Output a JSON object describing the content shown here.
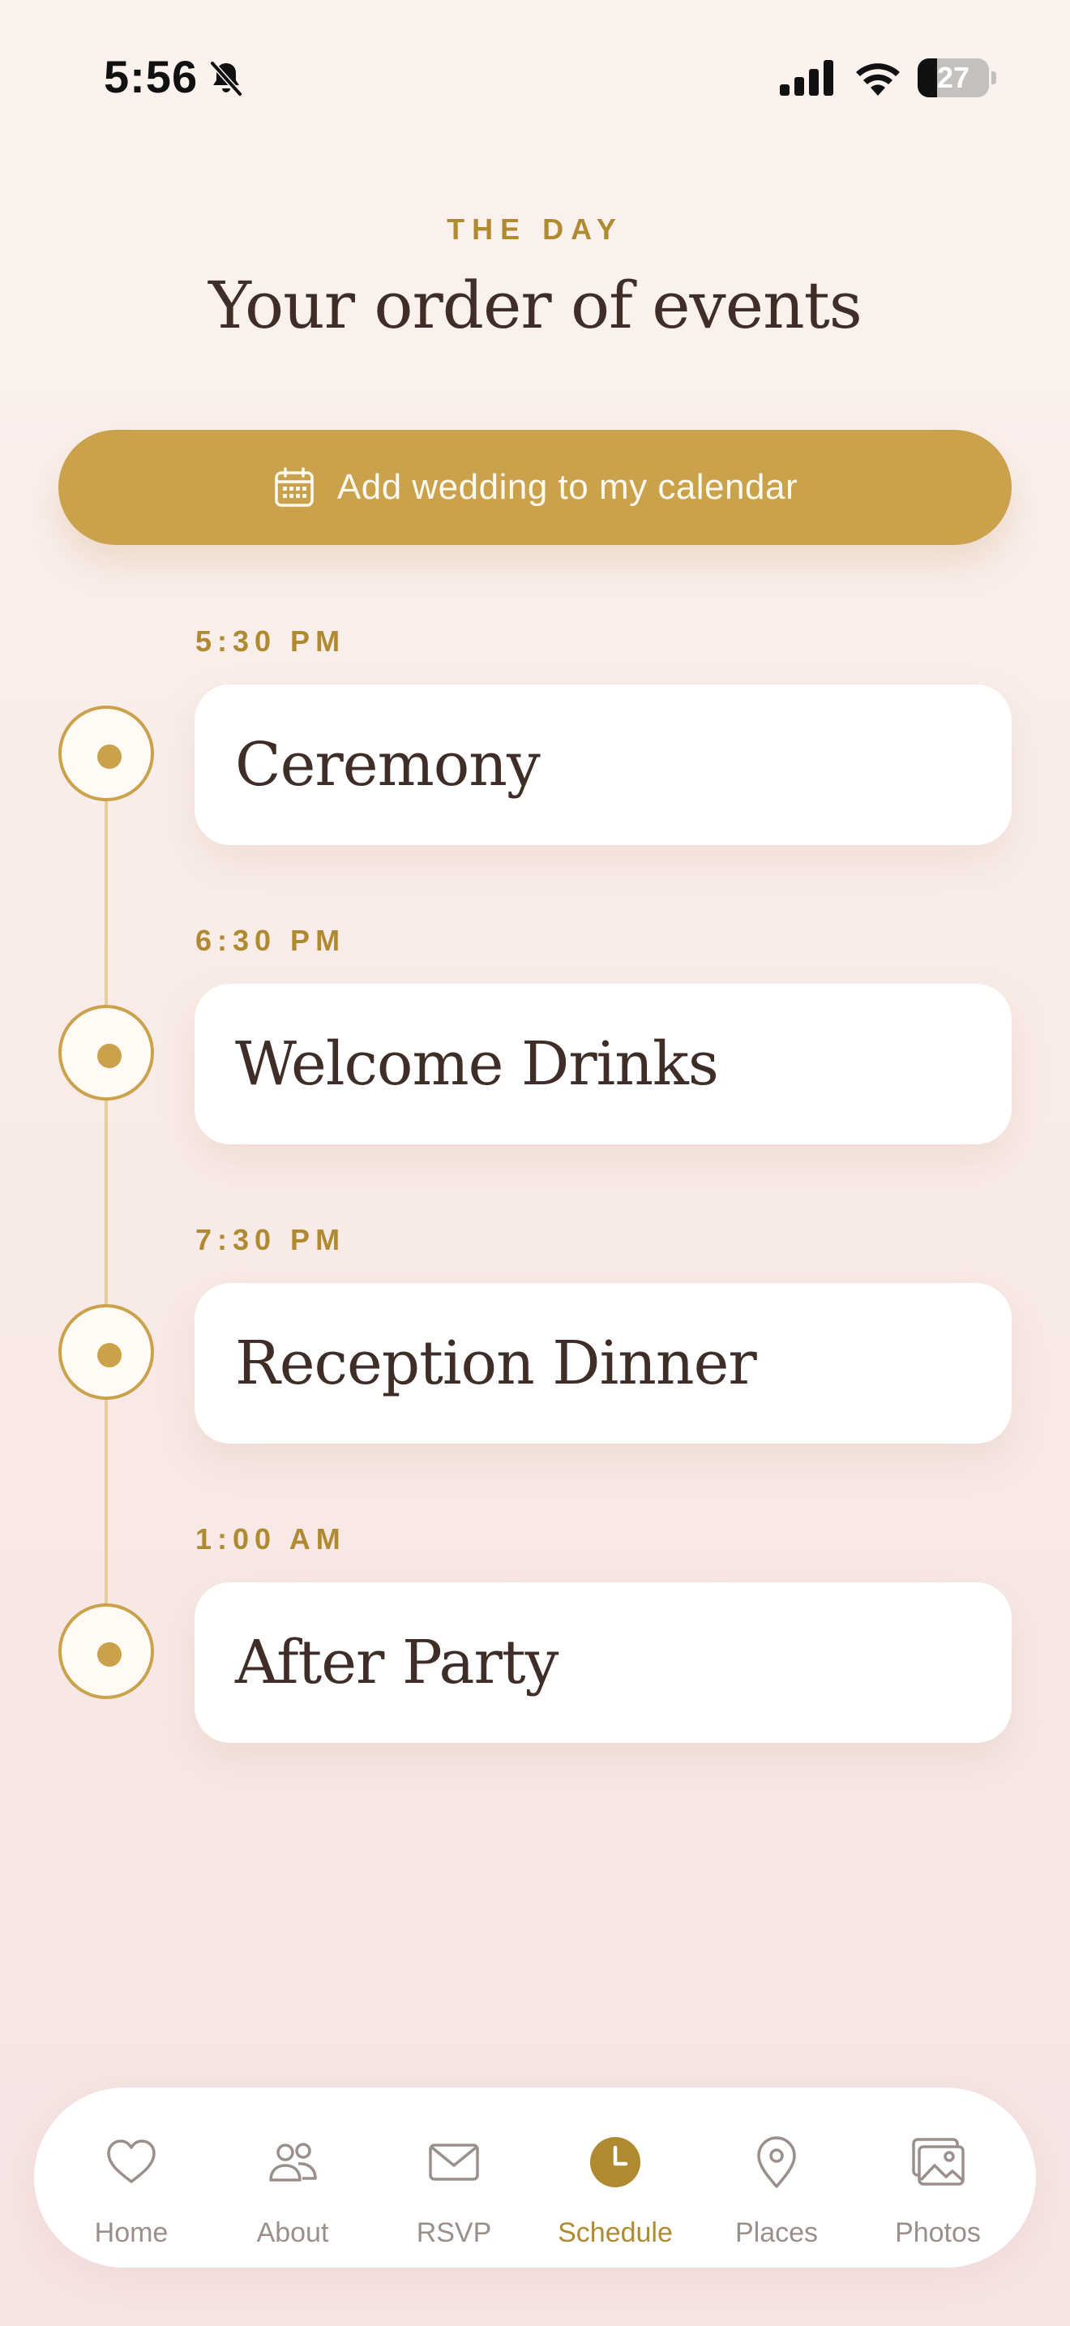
{
  "status_bar": {
    "time": "5:56",
    "battery": "27",
    "battery_level": 0.27,
    "icons": [
      "bell-slash-icon",
      "cellular-signal-icon",
      "wifi-icon",
      "battery-icon"
    ]
  },
  "header": {
    "eyebrow": "THE DAY",
    "title": "Your order of events"
  },
  "cta": {
    "label": "Add wedding to my calendar",
    "icon": "calendar-icon"
  },
  "events": [
    {
      "time": "5:30 PM",
      "title": "Ceremony"
    },
    {
      "time": "6:30 PM",
      "title": "Welcome Drinks"
    },
    {
      "time": "7:30 PM",
      "title": "Reception Dinner"
    },
    {
      "time": "1:00 AM",
      "title": "After Party"
    }
  ],
  "tabs": [
    {
      "label": "Home",
      "icon": "heart-icon",
      "active": false
    },
    {
      "label": "About",
      "icon": "people-icon",
      "active": false
    },
    {
      "label": "RSVP",
      "icon": "envelope-icon",
      "active": false
    },
    {
      "label": "Schedule",
      "icon": "clock-icon",
      "active": true
    },
    {
      "label": "Places",
      "icon": "map-pin-icon",
      "active": false
    },
    {
      "label": "Photos",
      "icon": "photos-icon",
      "active": false
    }
  ],
  "colors": {
    "accent": "#c9a24b",
    "accent_text": "#b08a30",
    "text": "#3f2e28",
    "inactive": "#9a8f8a",
    "background": "#fbf2ee"
  }
}
